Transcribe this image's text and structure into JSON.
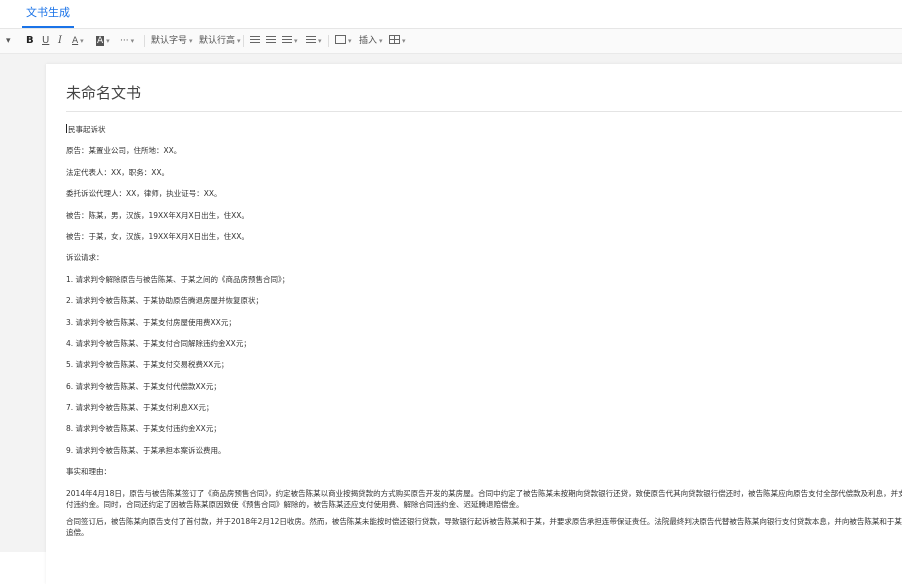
{
  "tabs": [
    {
      "label": "文书生成"
    }
  ],
  "toolbar": {
    "bold": "B",
    "underline": "U",
    "italic": "I",
    "font_color": "A",
    "highlight": "A",
    "more": "···",
    "font_size": "默认字号",
    "line_height": "默认行高",
    "insert": "插入"
  },
  "document": {
    "title": "未命名文书",
    "lines": [
      "民事起诉状",
      "原告：某置业公司，住所地：XX。",
      "法定代表人：XX，职务：XX。",
      "委托诉讼代理人：XX，律师，执业证号：XX。",
      "被告：陈某，男，汉族，19XX年X月X日出生，住XX。",
      "被告：于某，女，汉族，19XX年X月X日出生，住XX。",
      "诉讼请求：",
      "1. 请求判令解除原告与被告陈某、于某之间的《商品房预售合同》；",
      "2. 请求判令被告陈某、于某协助原告腾退房屋并恢复原状；",
      "3. 请求判令被告陈某、于某支付房屋使用费XX元；",
      "4. 请求判令被告陈某、于某支付合同解除违约金XX元；",
      "5. 请求判令被告陈某、于某支付交易税费XX元；",
      "6. 请求判令被告陈某、于某支付代偿款XX元；",
      "7. 请求判令被告陈某、于某支付利息XX元；",
      "8. 请求判令被告陈某、于某支付违约金XX元；",
      "9. 请求判令被告陈某、于某承担本案诉讼费用。",
      "事实和理由："
    ],
    "paragraphs": [
      "2014年4月18日，原告与被告陈某签订了《商品房预售合同》，约定被告陈某以商业按揭贷款的方式购买原告开发的某房屋。合同中约定了被告陈某未按期向贷款银行还贷，致使原告代其向贷款银行偿还时，被告陈某应向原告支付全部代偿款及利息，并支付违约金。同时，合同还约定了因被告陈某原因致使《预售合同》解除的，被告陈某还应支付使用费、解除合同违约金、迟延腾退赔偿金。",
      "合同签订后，被告陈某向原告支付了首付款，并于2018年2月12日收房。然而，被告陈某未能按时偿还银行贷款，导致银行起诉被告陈某和于某，并要求原告承担连带保证责任。法院最终判决原告代替被告陈某向银行支付贷款本息，并向被告陈某和于某追偿。"
    ]
  }
}
